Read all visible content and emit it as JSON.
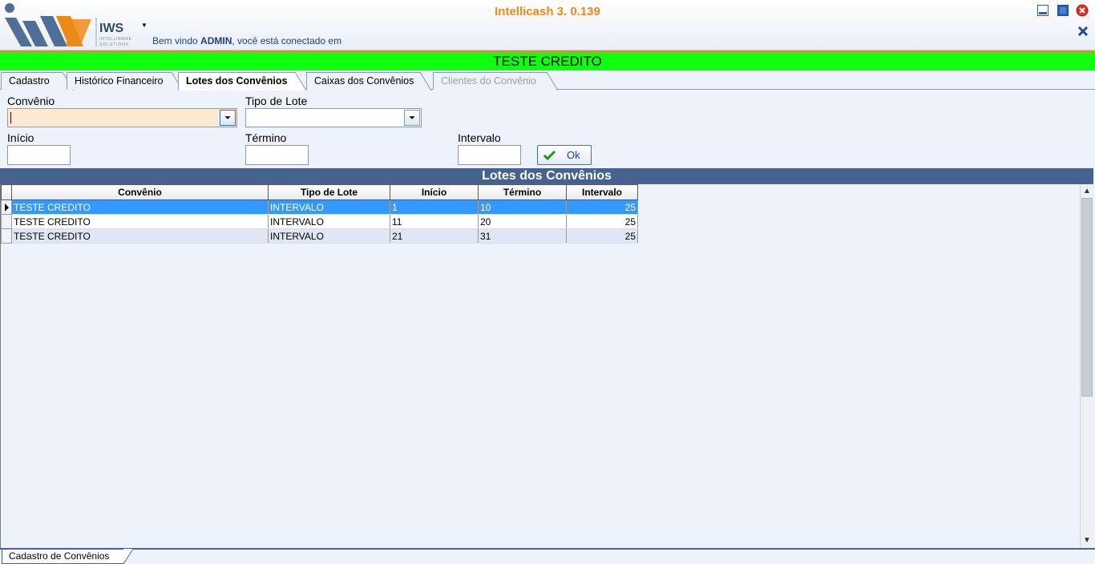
{
  "window": {
    "title": "Intellicash 3. 0.139",
    "logo_text": "IWS",
    "logo_subtext": "INTELLIWARE SOLUTIONS",
    "welcome_prefix": "Bem vindo ",
    "welcome_user": "ADMIN",
    "welcome_suffix": ", você está conectado em",
    "colors": {
      "title": "#f08a17",
      "banner": "#10ff10",
      "grid_header": "#46628f",
      "selection": "#3399ff"
    }
  },
  "record": {
    "title": "TESTE CREDITO"
  },
  "tabs": [
    {
      "label": "Cadastro",
      "state": "normal"
    },
    {
      "label": "Histórico Financeiro",
      "state": "normal"
    },
    {
      "label": "Lotes dos Convênios",
      "state": "active"
    },
    {
      "label": "Caixas dos Convênios",
      "state": "normal"
    },
    {
      "label": "Clientes do Convênio",
      "state": "disabled"
    }
  ],
  "form": {
    "convenio_label": "Convênio",
    "convenio_value": "",
    "tipo_lote_label": "Tipo de Lote",
    "tipo_lote_value": "",
    "inicio_label": "Início",
    "inicio_value": "",
    "termino_label": "Término",
    "termino_value": "",
    "intervalo_label": "Intervalo",
    "intervalo_value": "",
    "ok_label": "Ok"
  },
  "grid": {
    "title": "Lotes dos Convênios",
    "columns": [
      "Convênio",
      "Tipo de Lote",
      "Início",
      "Término",
      "Intervalo"
    ],
    "rows": [
      [
        "TESTE CREDITO",
        "INTERVALO",
        "1",
        "10",
        "25"
      ],
      [
        "TESTE CREDITO",
        "INTERVALO",
        "11",
        "20",
        "25"
      ],
      [
        "TESTE CREDITO",
        "INTERVALO",
        "21",
        "31",
        "25"
      ]
    ],
    "selected_row": 0
  },
  "bottom_tabs": [
    {
      "label": "Cadastro de Convênios"
    }
  ]
}
